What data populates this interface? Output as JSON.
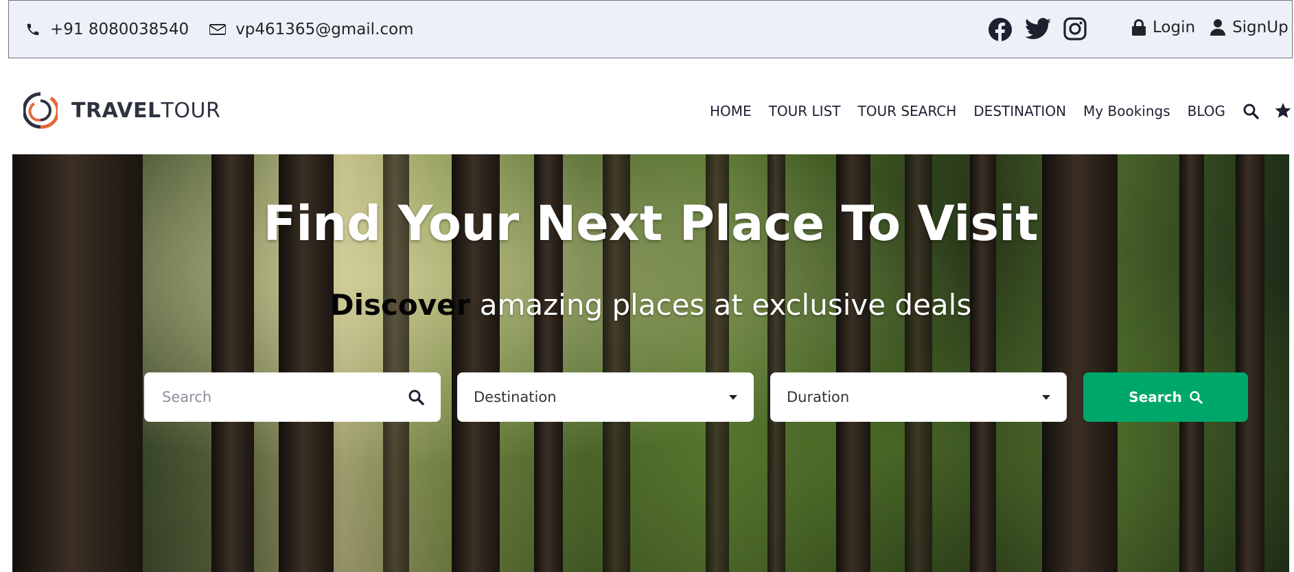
{
  "topbar": {
    "phone": "+91 8080038540",
    "email": "vp461365@gmail.com",
    "social": [
      "facebook-icon",
      "twitter-icon",
      "instagram-icon"
    ],
    "login_label": "Login",
    "signup_label": "SignUp"
  },
  "brand": {
    "name_bold": "TRAVEL",
    "name_light": "TOUR",
    "colors": {
      "ring_dark": "#2e3340",
      "ring_accent": "#e8673a"
    }
  },
  "nav": {
    "items": [
      "HOME",
      "TOUR LIST",
      "TOUR SEARCH",
      "DESTINATION",
      "My Bookings",
      "BLOG"
    ],
    "icons": [
      "search-icon",
      "star-icon"
    ]
  },
  "hero": {
    "title": "Find Your Next Place To Visit",
    "subtitle_bold": "Discover",
    "subtitle_rest": "amazing places at exclusive deals"
  },
  "search": {
    "placeholder": "Search",
    "destination_label": "Destination",
    "duration_label": "Duration",
    "button_label": "Search",
    "accent": "#00a76a"
  }
}
